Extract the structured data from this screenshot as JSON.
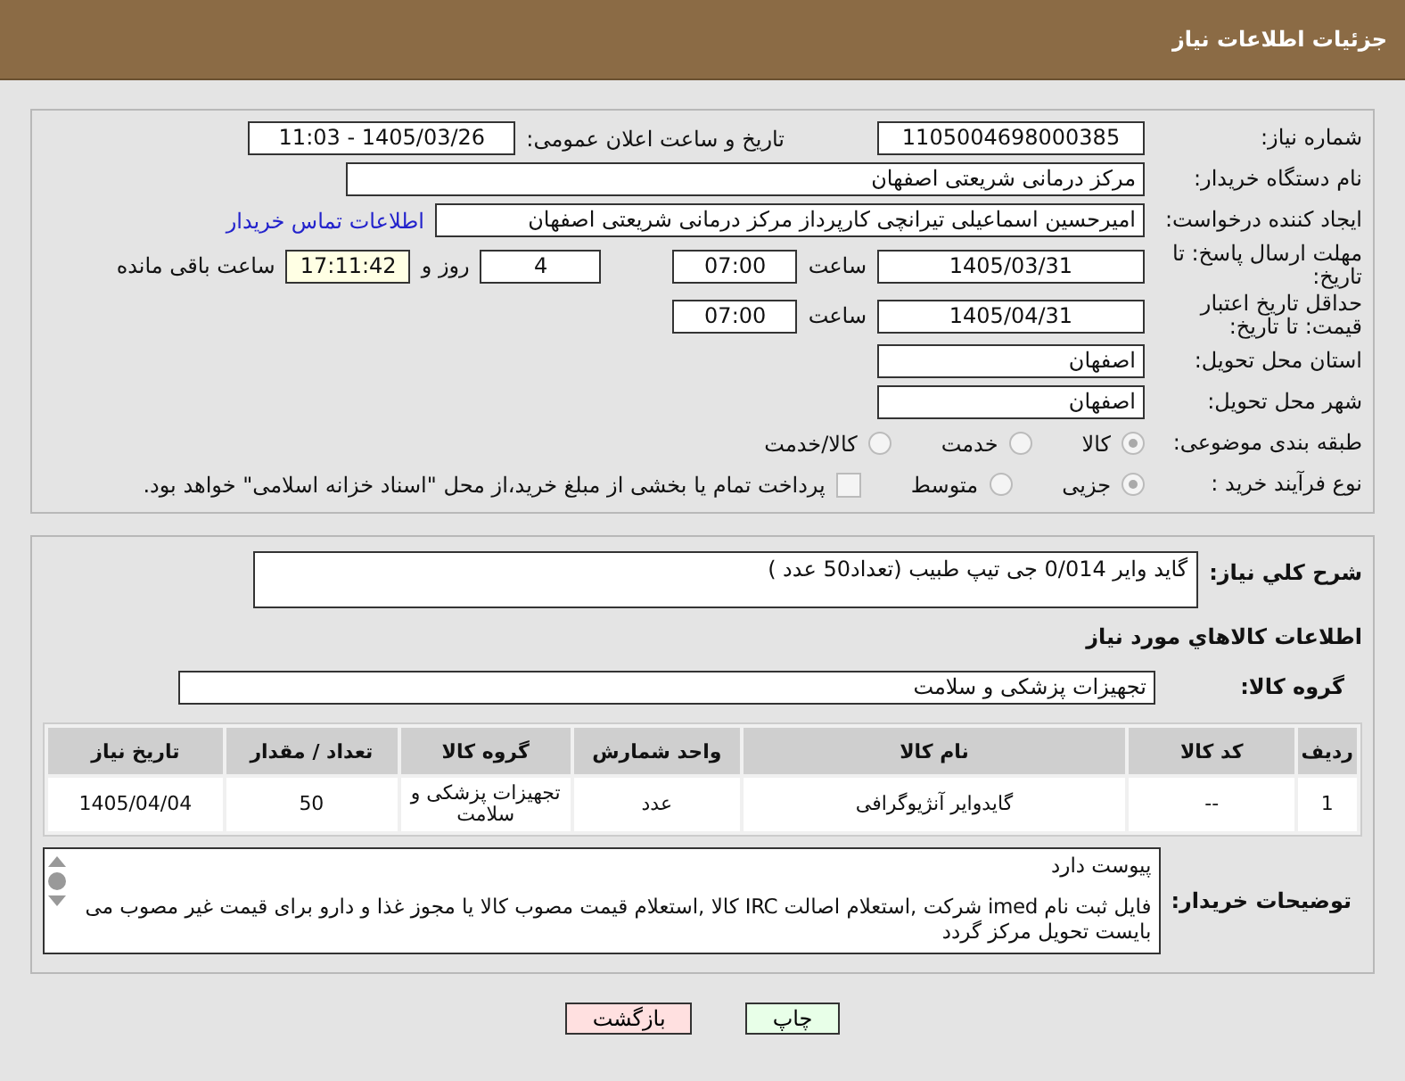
{
  "header": {
    "title": "جزئیات اطلاعات نیاز"
  },
  "need_number": {
    "label": "شماره نیاز:",
    "value": "1105004698000385"
  },
  "announce": {
    "label": "تاریخ و ساعت اعلان عمومی:",
    "value": "1405/03/26 - 11:03"
  },
  "buyer": {
    "label": "نام دستگاه خریدار:",
    "value": "مرکز درمانی شریعتی اصفهان"
  },
  "creator": {
    "label": "ایجاد کننده درخواست:",
    "value": "امیرحسین اسماعیلی تیرانچی کارپرداز مرکز درمانی شریعتی اصفهان",
    "link": "اطلاعات تماس خریدار"
  },
  "deadline": {
    "label": "مهلت ارسال پاسخ: تا تاریخ:",
    "date": "1405/03/31",
    "time_label": "ساعت",
    "time": "07:00",
    "days": "4",
    "days_label": "روز و",
    "remaining": "17:11:42",
    "remaining_label": "ساعت باقی مانده"
  },
  "validity": {
    "label": "حداقل تاریخ اعتبار قیمت: تا تاریخ:",
    "date": "1405/04/31",
    "time_label": "ساعت",
    "time": "07:00"
  },
  "province": {
    "label": "استان محل تحویل:",
    "value": "اصفهان"
  },
  "city": {
    "label": "شهر محل تحویل:",
    "value": "اصفهان"
  },
  "category": {
    "label": "طبقه بندی موضوعی:",
    "options": [
      {
        "label": "کالا",
        "selected": true
      },
      {
        "label": "خدمت",
        "selected": false
      },
      {
        "label": "کالا/خدمت",
        "selected": false
      }
    ]
  },
  "process": {
    "label": "نوع فرآیند خرید :",
    "options": [
      {
        "label": "جزیی",
        "selected": true
      },
      {
        "label": "متوسط",
        "selected": false
      }
    ],
    "treasury": {
      "label": "پرداخت تمام یا بخشی از مبلغ خرید،از محل \"اسناد خزانه اسلامی\" خواهد بود.",
      "checked": false
    }
  },
  "summary": {
    "label": "شرح کلي نياز:",
    "value": "گاید وایر 0/014 جی تیپ طبیب (تعداد50 عدد )"
  },
  "goods_title": "اطلاعات کالاهاي مورد نياز",
  "goods_group": {
    "label": "گروه کالا:",
    "value": "تجهیزات پزشکی و سلامت"
  },
  "table": {
    "columns": [
      "ردیف",
      "کد کالا",
      "نام کالا",
      "واحد شمارش",
      "گروه کالا",
      "تعداد / مقدار",
      "تاریخ نیاز"
    ],
    "rows": [
      [
        "1",
        "--",
        "گایدوایر آنژیوگرافی",
        "عدد",
        "تجهیزات پزشکی و سلامت",
        "50",
        "1405/04/04"
      ]
    ]
  },
  "notes": {
    "label": "توضیحات خریدار:",
    "lines": [
      "پیوست دارد",
      "فایل ثبت نام imed شرکت ,استعلام اصالت IRC کالا ,استعلام قیمت مصوب کالا یا مجوز غذا و دارو برای قیمت غیر مصوب می بایست تحویل مرکز گردد"
    ]
  },
  "buttons": [
    {
      "label": "چاپ",
      "kind": "print"
    },
    {
      "label": "بازگشت",
      "kind": "back"
    }
  ]
}
